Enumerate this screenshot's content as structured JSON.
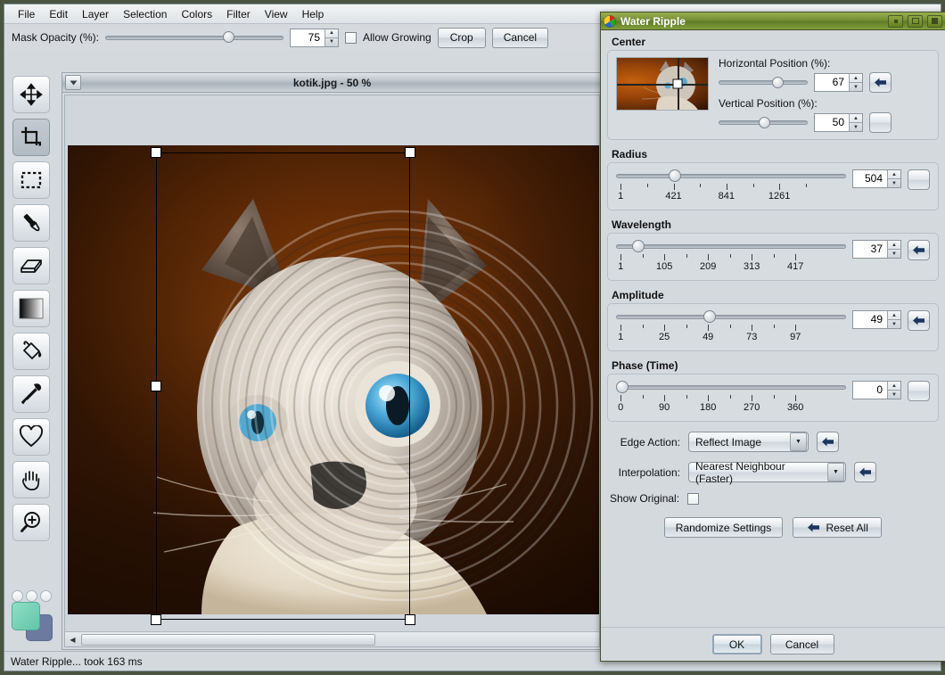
{
  "app": {
    "menu": [
      "File",
      "Edit",
      "Layer",
      "Selection",
      "Colors",
      "Filter",
      "View",
      "Help"
    ],
    "status_text": "Water Ripple... took 163 ms"
  },
  "tool_options": {
    "mask_opacity_label": "Mask Opacity (%):",
    "mask_opacity_value": "75",
    "mask_opacity_percent": 75,
    "allow_growing_label": "Allow Growing",
    "allow_growing_checked": false,
    "crop_label": "Crop",
    "cancel_label": "Cancel"
  },
  "toolbox": {
    "tools": [
      {
        "name": "move-tool",
        "icon": "move-icon",
        "active": false
      },
      {
        "name": "crop-tool",
        "icon": "crop-icon",
        "active": true
      },
      {
        "name": "rectangle-select-tool",
        "icon": "marquee-icon",
        "active": false
      },
      {
        "name": "paintbrush-tool",
        "icon": "paintbrush-icon",
        "active": false
      },
      {
        "name": "eraser-tool",
        "icon": "eraser-icon",
        "active": false
      },
      {
        "name": "gradient-tool",
        "icon": "gradient-icon",
        "active": false
      },
      {
        "name": "paint-bucket-tool",
        "icon": "bucket-icon",
        "active": false
      },
      {
        "name": "color-picker-tool",
        "icon": "eyedropper-icon",
        "active": false
      },
      {
        "name": "shape-tool",
        "icon": "heart-icon",
        "active": false
      },
      {
        "name": "pan-tool",
        "icon": "hand-icon",
        "active": false
      },
      {
        "name": "zoom-tool",
        "icon": "magnifier-plus-icon",
        "active": false
      }
    ],
    "foreground_color": "#7ad3b4",
    "background_color": "#6b7a9e"
  },
  "document": {
    "title": "kotik.jpg - 50 %",
    "zoom_percent": 50,
    "filename": "kotik.jpg"
  },
  "dialog": {
    "title": "Water Ripple",
    "window_buttons": [
      "minimize",
      "maximize",
      "close"
    ],
    "center": {
      "group_title": "Center",
      "horizontal_label": "Horizontal Position (%):",
      "horizontal_value": "67",
      "horizontal_percent": 67,
      "vertical_label": "Vertical Position (%):",
      "vertical_value": "50",
      "vertical_percent": 50
    },
    "radius": {
      "group_title": "Radius",
      "value": "504",
      "knob_percent": 23,
      "tick_labels": [
        "1",
        "421",
        "841",
        "1261"
      ],
      "tick_positions": [
        2,
        25,
        48,
        71
      ],
      "min": 1,
      "max": 1681
    },
    "wavelength": {
      "group_title": "Wavelength",
      "value": "37",
      "knob_percent": 7,
      "tick_labels": [
        "1",
        "105",
        "209",
        "313",
        "417"
      ],
      "tick_positions": [
        2,
        21,
        40,
        59,
        78
      ],
      "min": 1,
      "max": 521
    },
    "amplitude": {
      "group_title": "Amplitude",
      "value": "49",
      "knob_percent": 47,
      "tick_labels": [
        "1",
        "25",
        "49",
        "73",
        "97"
      ],
      "tick_positions": [
        2,
        21,
        40,
        59,
        78
      ],
      "min": 1,
      "max": 121
    },
    "phase": {
      "group_title": "Phase (Time)",
      "value": "0",
      "knob_percent": 0,
      "tick_labels": [
        "0",
        "90",
        "180",
        "270",
        "360"
      ],
      "tick_positions": [
        2,
        21,
        40,
        59,
        78
      ],
      "min": 0,
      "max": 450
    },
    "edge_action": {
      "label": "Edge Action:",
      "value": "Reflect Image"
    },
    "interpolation": {
      "label": "Interpolation:",
      "value": "Nearest Neighbour (Faster)"
    },
    "show_original": {
      "label": "Show Original:",
      "checked": false
    },
    "randomize_label": "Randomize Settings",
    "reset_all_label": "Reset All",
    "ok_label": "OK",
    "cancel_label": "Cancel"
  }
}
